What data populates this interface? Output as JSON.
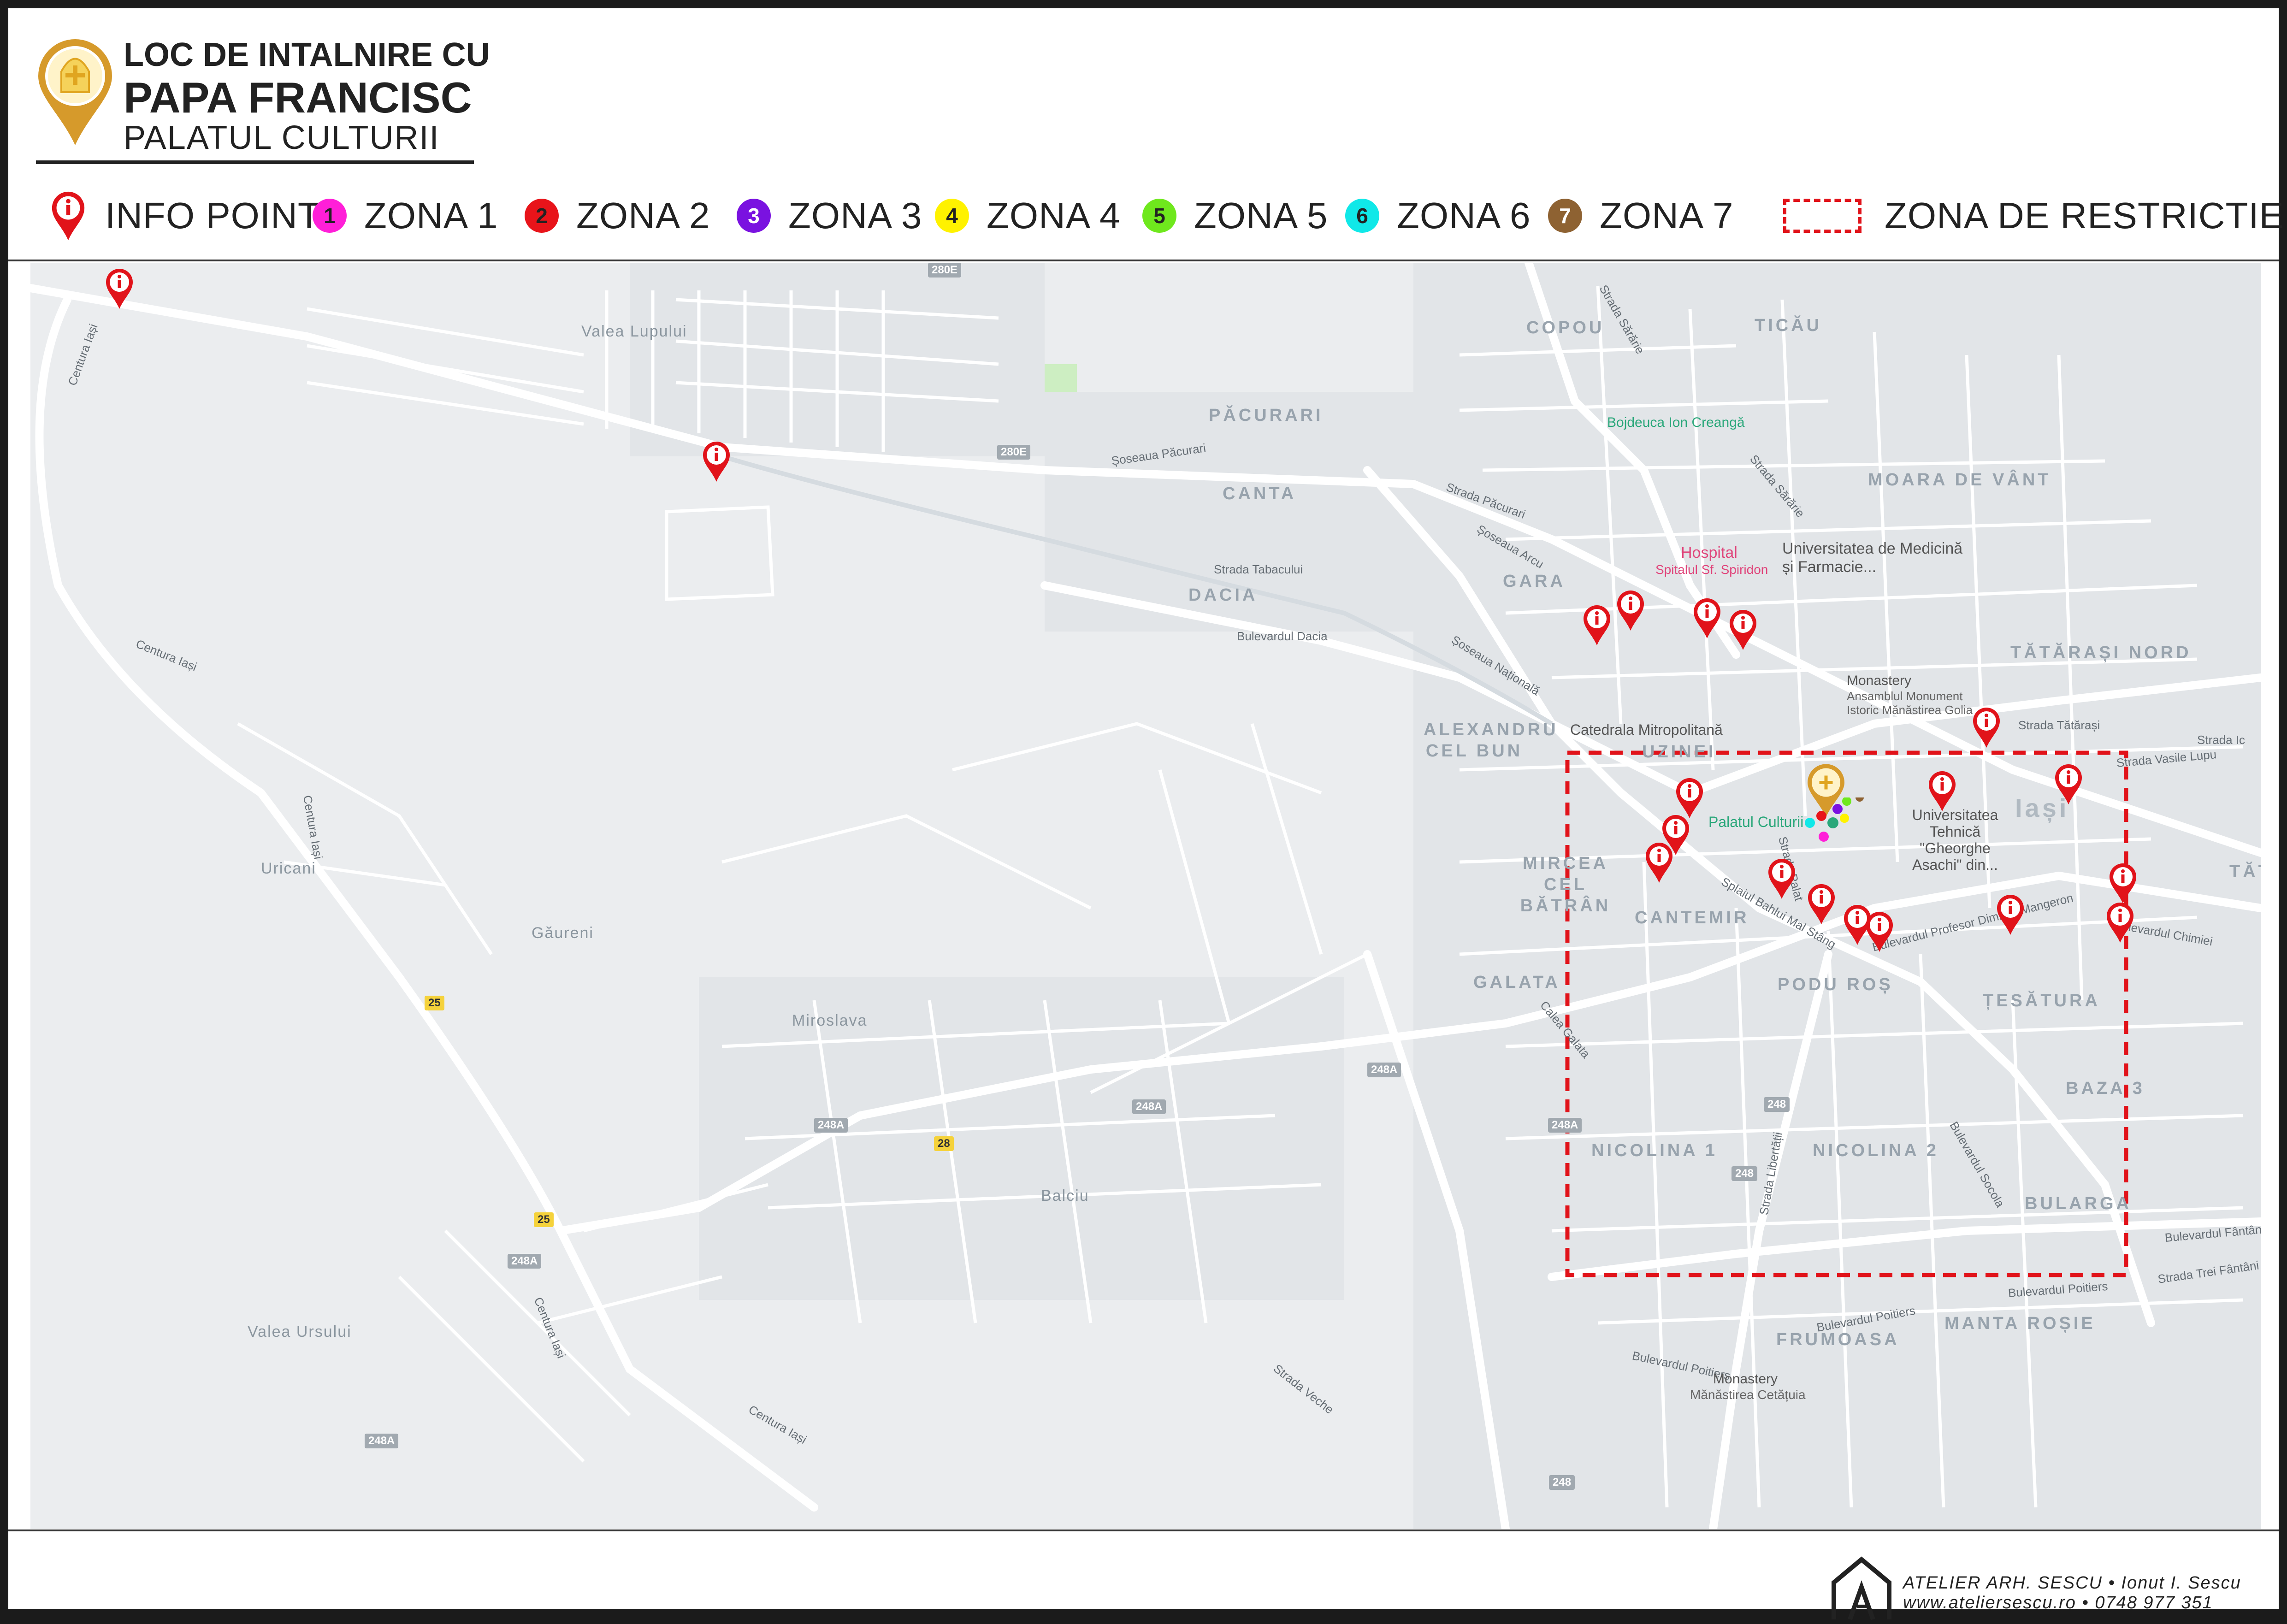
{
  "header": {
    "title_line1": "LOC DE INTALNIRE CU",
    "title_line2": "PAPA FRANCISC",
    "title_line3": "PALATUL CULTURII"
  },
  "legend": {
    "info_point": "INFO POINT",
    "zones": [
      {
        "number": "1",
        "label": "ZONA 1",
        "color": "#ff1fd8",
        "text_color": "#222222"
      },
      {
        "number": "2",
        "label": "ZONA 2",
        "color": "#e8141a",
        "text_color": "#222222"
      },
      {
        "number": "3",
        "label": "ZONA 3",
        "color": "#7a12e0",
        "text_color": "#ffffff"
      },
      {
        "number": "4",
        "label": "ZONA 4",
        "color": "#fff200",
        "text_color": "#222222"
      },
      {
        "number": "5",
        "label": "ZONA 5",
        "color": "#6fe81d",
        "text_color": "#222222"
      },
      {
        "number": "6",
        "label": "ZONA 6",
        "color": "#10e8e8",
        "text_color": "#222222"
      },
      {
        "number": "7",
        "label": "ZONA 7",
        "color": "#8e6232",
        "text_color": "#ffffff"
      }
    ],
    "restriction": "ZONA DE RESTRICTIE"
  },
  "colors": {
    "info_pin": "#e1131a",
    "restriction": "#e1131a",
    "pope_marker": "#d69a2b",
    "road": "#ffffff",
    "map_bg": "#ebedef",
    "park": "#c9edc0"
  },
  "map": {
    "districts": [
      "Valea Lupului",
      "COPOU",
      "TICĂU",
      "PĂCURARI",
      "CANTA",
      "MOARA DE VÂNT",
      "GARA",
      "DACIA",
      "TĂTĂRAȘI NORD",
      "ALEXANDRU CEL BUN",
      "UZINEI",
      "Iași",
      "MIRCEA CEL BĂTRÂN",
      "CANTEMIR",
      "PODU ROȘ",
      "ȚESĂTURA",
      "GALATA",
      "Uricani",
      "Găureni",
      "Miroslava",
      "BAZA 3",
      "NICOLINA 1",
      "NICOLINA 2",
      "Balciu",
      "BULARGA",
      "Valea Ursului",
      "FRUMOASA",
      "MANTA ROȘIE",
      "TĂT"
    ],
    "streets": [
      "Centura Iași",
      "Centura Iași",
      "Centura Iași",
      "Centura Iași",
      "Centura Iași",
      "Șoseaua Păcurari",
      "Strada Păcurari",
      "Șoseaua Arcu",
      "Strada Tabacului",
      "Bulevardul Dacia",
      "Șoseaua Națională",
      "Strada Sărărie",
      "Strada Sărărie",
      "Strada Tătărași",
      "Strada Vasile Lupu",
      "Strada Ic",
      "Splaiul Bahlui Mal Stâng",
      "Strada Palat",
      "Bulevardul Profesor Dimitrie Mangeron",
      "Bulevardul Chimiei",
      "Calea Galata",
      "Bulevardul Socola",
      "Strada Libertății",
      "Bulevardul Poitiers",
      "Bulevardul Poitiers",
      "Bulevardul Poitiers",
      "Bulevardul Fântânilor",
      "Strada Trei Fântâni",
      "Strada Veche"
    ],
    "pois": [
      "Bojdeuca Ion Creangă",
      "Hospital",
      "Spitalul Sf. Spiridon",
      "Universitatea de Medicină și Farmacie...",
      "Monastery",
      "Ansamblul Monument Istoric Mănăstirea Golia",
      "Catedrala Mitropolitană",
      "Palatul Culturii",
      "Universitatea Tehnică \"Gheorghe Asachi\" din...",
      "Monastery",
      "Mănăstirea Cetățuia"
    ],
    "shields": [
      "280E",
      "280E",
      "25",
      "25",
      "248A",
      "248A",
      "248A",
      "248A",
      "248A",
      "248A",
      "28",
      "248",
      "248",
      "248"
    ]
  },
  "footer": {
    "line1_studio": "ATELIER ARH. SESCU",
    "line1_person": "Ionut I. Sescu",
    "line2_web": "www.ateliersescu.ro",
    "line2_phone": "0748 977 351"
  }
}
